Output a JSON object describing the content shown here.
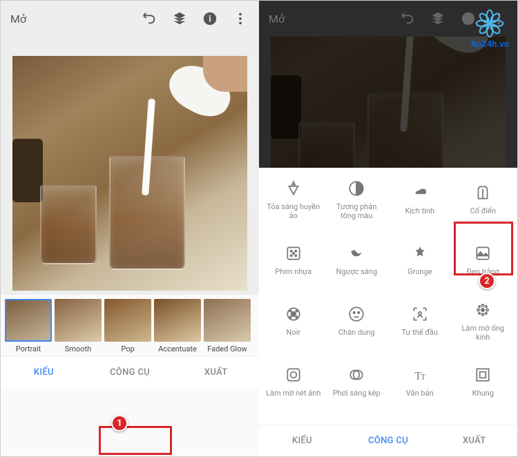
{
  "left": {
    "open_label": "Mở",
    "looks": [
      {
        "label": "Portrait",
        "selected": true
      },
      {
        "label": "Smooth"
      },
      {
        "label": "Pop"
      },
      {
        "label": "Accentuate"
      },
      {
        "label": "Faded Glow"
      }
    ],
    "tabs": {
      "looks": "KIỂU",
      "tools": "CÔNG CỤ",
      "export": "XUẤT"
    },
    "marker": "1"
  },
  "right": {
    "open_label": "Mở",
    "tools": [
      {
        "label": "Tỏa sáng huyền ảo",
        "icon": "glamour"
      },
      {
        "label": "Tương phản tông màu",
        "icon": "tonal"
      },
      {
        "label": "Kịch tính",
        "icon": "drama"
      },
      {
        "label": "Cổ điển",
        "icon": "vintage"
      },
      {
        "label": "Phim nhựa",
        "icon": "grainy"
      },
      {
        "label": "Ngược sáng",
        "icon": "retrolux"
      },
      {
        "label": "Grunge",
        "icon": "grunge"
      },
      {
        "label": "Đen trắng",
        "icon": "bw",
        "highlighted": true
      },
      {
        "label": "Noir",
        "icon": "noir"
      },
      {
        "label": "Chân dung",
        "icon": "portrait"
      },
      {
        "label": "Tư thế đầu",
        "icon": "headpose"
      },
      {
        "label": "Làm mờ ống kính",
        "icon": "lensblur"
      },
      {
        "label": "Làm mờ nét ảnh",
        "icon": "vignette"
      },
      {
        "label": "Phơi sáng kép",
        "icon": "doubleexp"
      },
      {
        "label": "Văn bản",
        "icon": "text"
      },
      {
        "label": "Khung",
        "icon": "frame"
      }
    ],
    "tabs": {
      "looks": "KIỂU",
      "tools": "CÔNG CỤ",
      "export": "XUẤT"
    },
    "marker": "2"
  },
  "watermark": "Ap24h.vn"
}
